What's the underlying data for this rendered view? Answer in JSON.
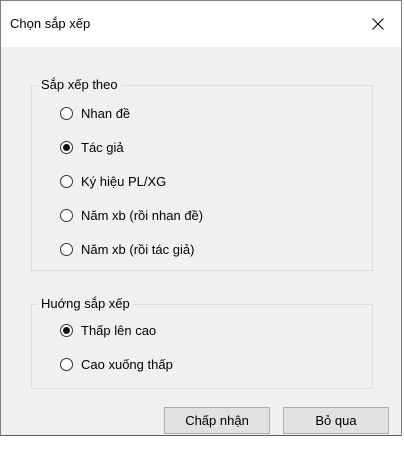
{
  "window": {
    "title": "Chọn sắp xếp",
    "close_icon": "close-icon"
  },
  "sort_by": {
    "label": "Sắp xếp theo",
    "options": [
      {
        "label": "Nhan đề",
        "checked": false
      },
      {
        "label": "Tác giả",
        "checked": true
      },
      {
        "label": "Ký hiệu PL/XG",
        "checked": false
      },
      {
        "label": "Năm xb (rồi nhan đề)",
        "checked": false
      },
      {
        "label": "Năm xb (rồi tác giả)",
        "checked": false
      }
    ]
  },
  "direction": {
    "label": "Huớng sắp xếp",
    "options": [
      {
        "label": "Thấp lên cao",
        "checked": true
      },
      {
        "label": "Cao xuống thấp",
        "checked": false
      }
    ]
  },
  "buttons": {
    "ok_label": "Chấp nhận",
    "cancel_label": "Bỏ qua"
  },
  "colors": {
    "dialog_bg": "#f0f0f0",
    "titlebar_bg": "#ffffff",
    "button_bg": "#e1e1e1",
    "button_border": "#adadad"
  }
}
